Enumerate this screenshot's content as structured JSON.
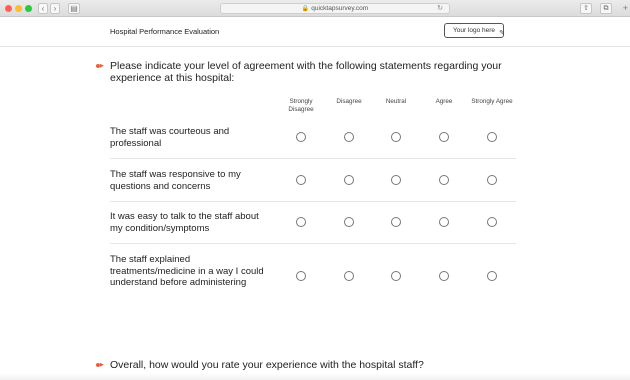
{
  "browser": {
    "url": "quicktapsurvey.com",
    "icons": [
      "lock-icon",
      "reload-icon",
      "share-icon",
      "tabs-icon",
      "new-tab-icon"
    ]
  },
  "header": {
    "title": "Hospital Performance Evaluation",
    "logo_placeholder": "Your logo here"
  },
  "question1": {
    "text": "Please indicate your level of agreement with the following statements regarding your experience at this hospital:",
    "columns": [
      "Strongly Disagree",
      "Disagree",
      "Neutral",
      "Agree",
      "Strongly Agree"
    ],
    "rows": [
      "The staff was courteous and professional",
      "The staff was responsive to my questions and concerns",
      "It was easy to talk to the staff about my condition/symptoms",
      "The staff explained treatments/medicine in a way I could understand before administering"
    ]
  },
  "question2": {
    "text": "Overall, how would you rate your experience with the hospital staff?"
  },
  "colors": {
    "accent": "#e8603c",
    "separator": "#e6e6e6"
  }
}
